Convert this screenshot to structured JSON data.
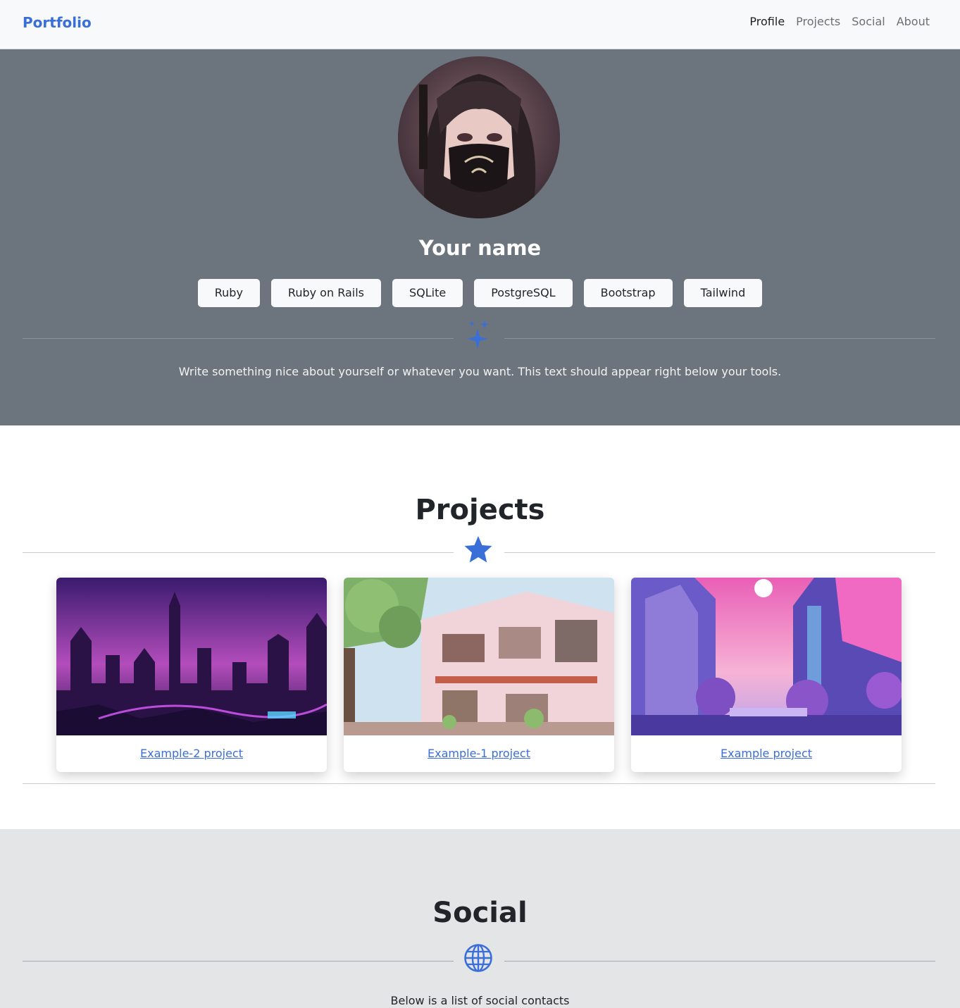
{
  "navbar": {
    "brand": "Portfolio",
    "links": [
      "Profile",
      "Projects",
      "Social",
      "About"
    ],
    "active": "Profile",
    "brand_color": "#3b6fd8"
  },
  "hero": {
    "name": "Your name",
    "tools": [
      "Ruby",
      "Ruby on Rails",
      "SQLite",
      "PostgreSQL",
      "Bootstrap",
      "Tailwind"
    ],
    "divider_icon": "sparkles-icon",
    "description": "Write something nice about yourself or whatever you want. This text should appear right below your tools.",
    "background": "#6c757d"
  },
  "projects": {
    "title": "Projects",
    "divider_icon": "star-icon",
    "cards": [
      {
        "link_text": "Example-2 project",
        "image": "neon-city-image"
      },
      {
        "link_text": "Example-1 project",
        "image": "anime-street-image"
      },
      {
        "link_text": "Example project",
        "image": "pink-city-image"
      }
    ]
  },
  "social": {
    "title": "Social",
    "divider_icon": "globe-icon",
    "description": "Below is a list of social contacts",
    "background": "#e4e5e7"
  },
  "accent_color": "#3b6fd8"
}
